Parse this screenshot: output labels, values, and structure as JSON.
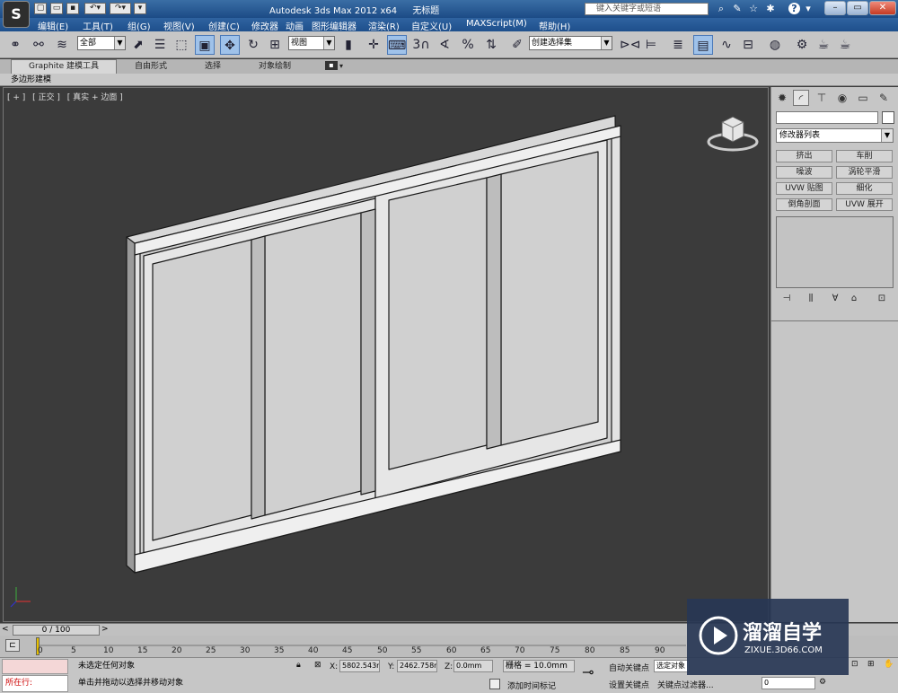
{
  "window": {
    "app_title": "Autodesk 3ds Max  2012 x64",
    "doc_title": "无标题",
    "logo": "S",
    "search_placeholder": "键入关键字或短语",
    "help": "?"
  },
  "menu": [
    "编辑(E)",
    "工具(T)",
    "组(G)",
    "视图(V)",
    "创建(C)",
    "修改器",
    "动画",
    "图形编辑器",
    "渲染(R)",
    "自定义(U)",
    "MAXScript(M)",
    "帮助(H)"
  ],
  "toolbar": {
    "selection_filter": "全部",
    "ref_coord": "视图",
    "named_selection": "创建选择集",
    "snap_label": "3",
    "percent": "%",
    "link_icon": "link-icon",
    "unlink_icon": "unlink-icon"
  },
  "ribbon": {
    "tabs": [
      "Graphite 建模工具",
      "自由形式",
      "选择",
      "对象绘制"
    ],
    "sub_label": "多边形建模"
  },
  "viewport": {
    "labels": [
      "[ + ]",
      "[ 正交 ]",
      "[ 真实 + 边面 ]"
    ]
  },
  "command_panel": {
    "modifier_list": "修改器列表",
    "modifiers": [
      "挤出",
      "车削",
      "噪波",
      "涡轮平滑",
      "UVW 贴图",
      "细化",
      "倒角剖面",
      "UVW 展开"
    ]
  },
  "timeline": {
    "frame": "0 / 100",
    "ticks": [
      "0",
      "5",
      "10",
      "15",
      "20",
      "25",
      "30",
      "35",
      "40",
      "45",
      "50",
      "55",
      "60",
      "65",
      "70",
      "75",
      "80",
      "85",
      "90"
    ]
  },
  "status": {
    "running": "所在行:",
    "selection": "未选定任何对象",
    "prompt": "单击并拖动以选择并移动对象",
    "x_label": "X:",
    "x_value": "5802.543m",
    "y_label": "Y:",
    "y_value": "2462.758m",
    "z_label": "Z:",
    "z_value": "0.0mm",
    "grid": "栅格 = 10.0mm",
    "add_time_tag": "添加时间标记",
    "auto_key": "自动关键点",
    "set_key": "设置关键点",
    "selected": "选定对象",
    "key_filters": "关键点过滤器...",
    "frame_field": "0"
  },
  "watermark": {
    "title": "溜溜自学",
    "url": "ZIXUE.3D66.COM"
  }
}
